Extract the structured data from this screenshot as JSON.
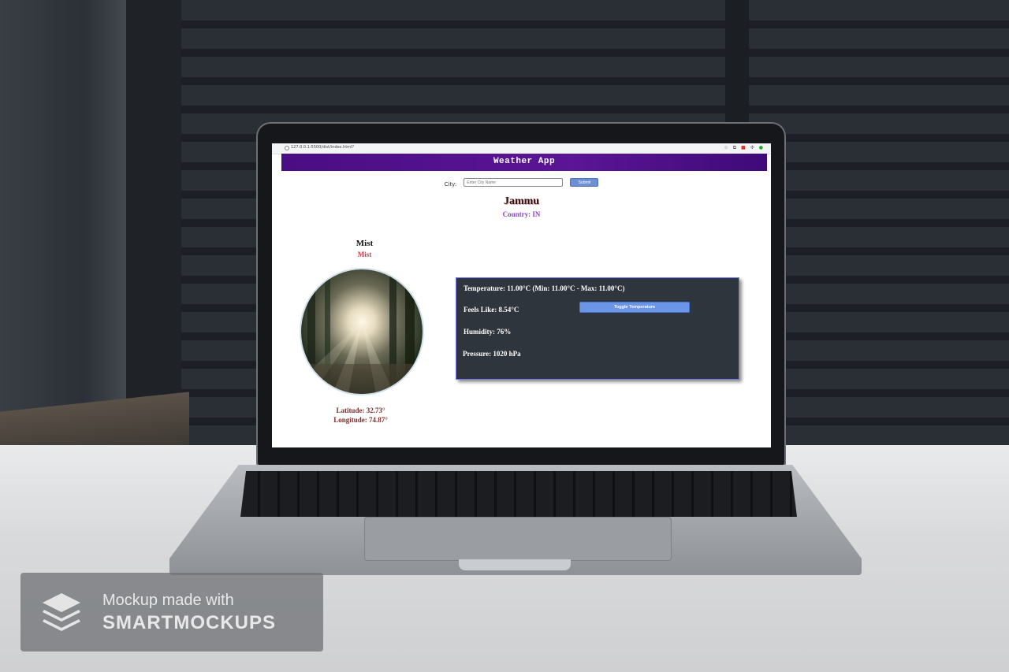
{
  "browser": {
    "url": "127.0.0.1:5500/dist/index.html?"
  },
  "app": {
    "title": "Weather App"
  },
  "search": {
    "label": "City:",
    "placeholder": "Enter City Name",
    "submit_label": "Submit"
  },
  "location": {
    "city": "Jammu",
    "country": "Country: IN",
    "latitude": "Latitude: 32.73°",
    "longitude": "Longitude: 74.87°"
  },
  "weather": {
    "main": "Mist",
    "description": "Mist"
  },
  "details": {
    "temperature": "Temperature: 11.00°C (Min: 11.00°C - Max: 11.00°C)",
    "feels_like": "Feels Like: 8.54°C",
    "humidity": "Humidity: 76%",
    "pressure": "Pressure: 1020 hPa",
    "toggle_label": "Toggle Temperature"
  },
  "watermark": {
    "line1": "Mockup made with",
    "line2": "SMARTMOCKUPS"
  },
  "colors": {
    "header": "#4a0d84",
    "card": "#2f353c",
    "button": "#6a95e8",
    "country": "#8b3fc9",
    "description": "#d23a4c"
  }
}
